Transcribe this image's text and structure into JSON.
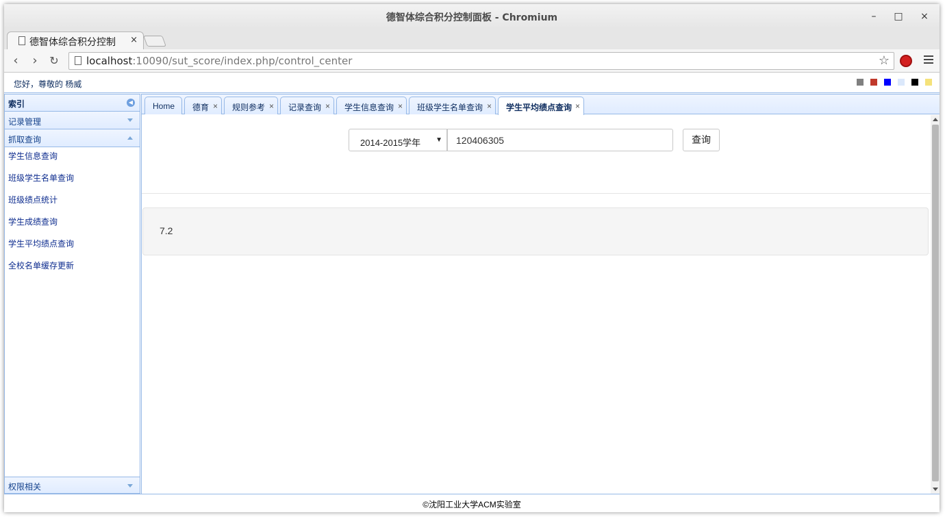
{
  "window": {
    "title": "德智体综合积分控制面板 - Chromium",
    "minimize": "–",
    "maximize": "□",
    "close": "×"
  },
  "browser": {
    "tab_title": "德智体综合积分控制",
    "tab_close": "×",
    "url_host": "localhost",
    "url_rest": ":10090/sut_score/index.php/control_center",
    "back": "‹",
    "forward": "›",
    "reload": "↻",
    "star": "☆"
  },
  "topbar": {
    "greeting": "您好，尊敬的 杨威",
    "theme_colors": [
      "#808080",
      "#c0392b",
      "#0000ff",
      "#dbe8fb",
      "#000000",
      "#f5e27a"
    ]
  },
  "west": {
    "title": "索引",
    "sections": {
      "records": "记录管理",
      "fetch": "抓取查询",
      "permissions": "权限相关"
    },
    "items": [
      "学生信息查询",
      "班级学生名单查询",
      "班级绩点统计",
      "学生成绩查询",
      "学生平均绩点查询",
      "全校名单缓存更新"
    ]
  },
  "tabs": [
    {
      "label": "Home",
      "closable": false
    },
    {
      "label": "德育",
      "closable": true
    },
    {
      "label": "规则参考",
      "closable": true
    },
    {
      "label": "记录查询",
      "closable": true
    },
    {
      "label": "学生信息查询",
      "closable": true
    },
    {
      "label": "班级学生名单查询",
      "closable": true
    },
    {
      "label": "学生平均绩点查询",
      "closable": true,
      "selected": true
    }
  ],
  "tab_close_glyph": "×",
  "form": {
    "year_select": "2014-2015学年",
    "student_id": "120406305",
    "query_button": "查询"
  },
  "result": {
    "gpa": "7.2"
  },
  "footer": {
    "text": "©沈阳工业大学ACM实验室"
  }
}
